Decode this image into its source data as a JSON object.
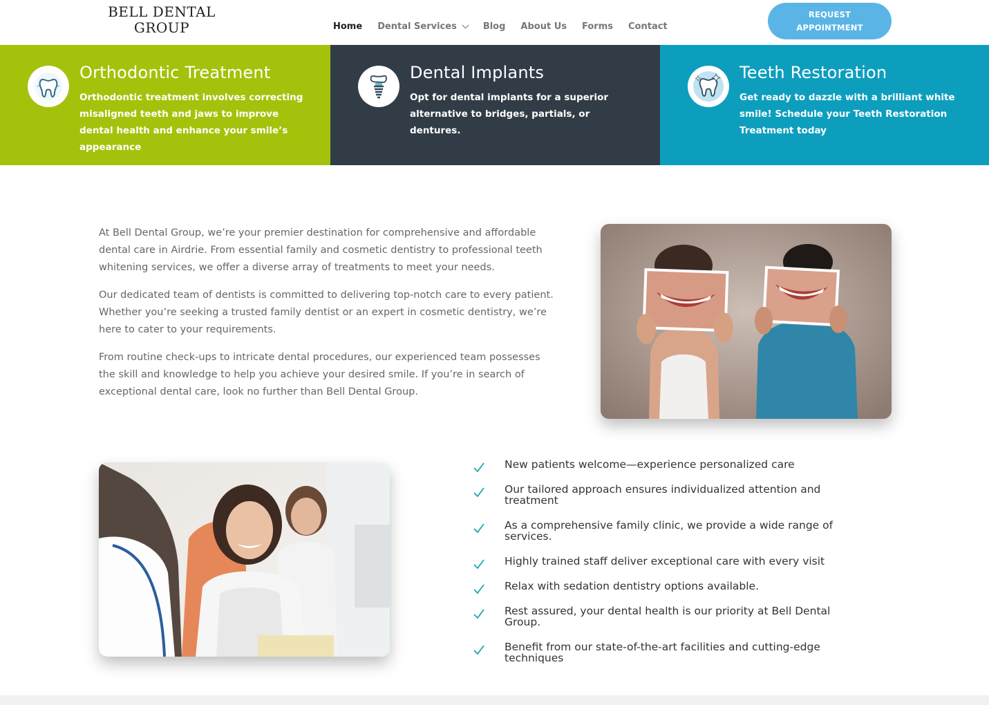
{
  "header": {
    "logo_line1": "BELL DENTAL",
    "logo_line2": "GROUP",
    "nav": [
      {
        "label": "Home"
      },
      {
        "label": "Dental Services"
      },
      {
        "label": "Blog"
      },
      {
        "label": "About Us"
      },
      {
        "label": "Forms"
      },
      {
        "label": "Contact"
      }
    ],
    "cta_line1": "REQUEST",
    "cta_line2": "APPOINTMENT"
  },
  "features": [
    {
      "title": "Orthodontic Treatment",
      "text": "Orthodontic treatment involves correcting misaligned teeth and jaws to improve dental health and enhance your smile’s appearance",
      "icon": "tooth-icon",
      "color": "#a4c20b"
    },
    {
      "title": "Dental Implants",
      "text": "Opt for dental implants for a superior alternative to bridges, partials, or dentures.",
      "icon": "implant-icon",
      "color": "#323c47"
    },
    {
      "title": "Teeth Restoration",
      "text": "Get ready to dazzle with a brilliant white smile! Schedule your Teeth Restoration Treatment today",
      "icon": "sparkle-tooth-icon",
      "color": "#0d9ebe"
    }
  ],
  "intro": {
    "p1": "At Bell Dental Group, we’re your premier destination for comprehensive and affordable dental care in Airdrie. From essential family and cosmetic dentistry to professional teeth whitening services, we offer a diverse array of treatments to meet your needs.",
    "p2": "Our dedicated team of dentists is committed to delivering top-notch care to every patient. Whether you’re seeking a trusted family dentist or an expert in cosmetic dentistry, we’re here to cater to your requirements.",
    "p3": "From routine check-ups to intricate dental procedures, our experienced team possesses the skill and knowledge to help you achieve your desired smile. If you’re in search of exceptional dental care, look no further than Bell Dental Group."
  },
  "checklist": [
    "New patients welcome—experience personalized care",
    "Our tailored approach ensures individualized attention and treatment",
    "As a comprehensive family clinic, we provide a wide range of services.",
    "Highly trained staff deliver exceptional care with every visit",
    "Relax with sedation dentistry options available.",
    "Rest assured, your dental health is our priority at Bell Dental Group.",
    "Benefit from our state-of-the-art facilities and cutting-edge techniques"
  ],
  "colors": {
    "accent": "#5ab5e6",
    "check": "#1ba7a7",
    "green": "#a4c20b",
    "dark": "#323c47",
    "teal": "#0d9ebe"
  }
}
